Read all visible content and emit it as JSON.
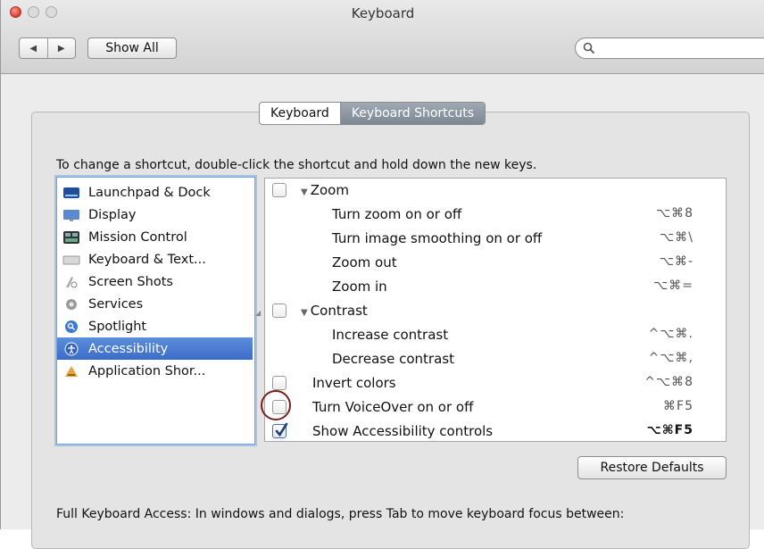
{
  "window": {
    "title": "Keyboard"
  },
  "toolbar": {
    "back_glyph": "◀",
    "forward_glyph": "▶",
    "show_all": "Show All",
    "search_placeholder": ""
  },
  "tabs": [
    {
      "label": "Keyboard",
      "selected": false
    },
    {
      "label": "Keyboard Shortcuts",
      "selected": true
    }
  ],
  "instruction": "To change a shortcut, double-click the shortcut and hold down the new keys.",
  "categories": [
    {
      "label": "Launchpad & Dock",
      "icon": "launchpad-icon",
      "selected": false
    },
    {
      "label": "Display",
      "icon": "display-icon",
      "selected": false
    },
    {
      "label": "Mission Control",
      "icon": "mission-control-icon",
      "selected": false
    },
    {
      "label": "Keyboard & Text...",
      "icon": "keyboard-icon",
      "selected": false
    },
    {
      "label": "Screen Shots",
      "icon": "screenshot-icon",
      "selected": false
    },
    {
      "label": "Services",
      "icon": "gear-icon",
      "selected": false
    },
    {
      "label": "Spotlight",
      "icon": "spotlight-icon",
      "selected": false
    },
    {
      "label": "Accessibility",
      "icon": "accessibility-icon",
      "selected": true
    },
    {
      "label": "Application Shor...",
      "icon": "app-shortcuts-icon",
      "selected": false
    }
  ],
  "shortcuts": [
    {
      "name": "Zoom",
      "key": "",
      "group": true,
      "checkbox": true,
      "checked": false
    },
    {
      "name": "Turn zoom on or off",
      "key": "⌥⌘8",
      "group": false,
      "checkbox": false
    },
    {
      "name": "Turn image smoothing on or off",
      "key": "⌥⌘\\",
      "group": false,
      "checkbox": false
    },
    {
      "name": "Zoom out",
      "key": "⌥⌘-",
      "group": false,
      "checkbox": false
    },
    {
      "name": "Zoom in",
      "key": "⌥⌘=",
      "group": false,
      "checkbox": false
    },
    {
      "name": "Contrast",
      "key": "",
      "group": true,
      "checkbox": true,
      "checked": false
    },
    {
      "name": "Increase contrast",
      "key": "^⌥⌘.",
      "group": false,
      "checkbox": false
    },
    {
      "name": "Decrease contrast",
      "key": "^⌥⌘,",
      "group": false,
      "checkbox": false
    },
    {
      "name": "Invert colors",
      "key": "^⌥⌘8",
      "group": false,
      "checkbox": true,
      "checked": false
    },
    {
      "name": "Turn VoiceOver on or off",
      "key": "⌘F5",
      "group": false,
      "checkbox": true,
      "checked": false
    },
    {
      "name": "Show Accessibility controls",
      "key": "⌥⌘F5",
      "group": false,
      "checkbox": true,
      "checked": true
    }
  ],
  "restore_defaults": "Restore Defaults",
  "full_keyboard_access": "Full Keyboard Access: In windows and dialogs, press Tab to move keyboard focus between:",
  "colors": {
    "selection": "#3c6cc8",
    "highlight_ring": "#7a1f1f"
  }
}
